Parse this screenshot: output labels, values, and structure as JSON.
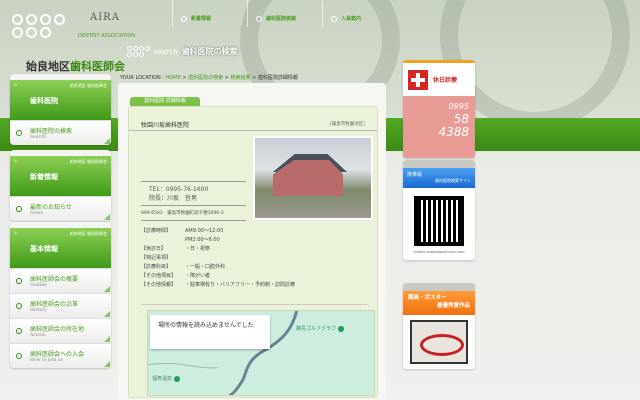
{
  "header": {
    "logo_text": "AIRA",
    "logo_sub": "DENTIST ASSOCIATION",
    "title_plain": "始良地区",
    "title_accent": "歯科医師会"
  },
  "top_nav": [
    {
      "label": "新着情報"
    },
    {
      "label": "歯科医院検索"
    },
    {
      "label": "入会案内"
    }
  ],
  "section_heading": {
    "search_word": "search",
    "title": "歯科医院の検索"
  },
  "breadcrumb": {
    "prefix": "YOUR LOCATION",
    "items": [
      "HOME",
      "歯科医院の検索",
      "検索結果"
    ],
    "current": "歯科医院詳細情報"
  },
  "sidebar": [
    {
      "sub": "姶良地区 歯科医師会",
      "title": "歯科医院",
      "items": [
        {
          "label": "歯科医院の検索",
          "en": "Search"
        }
      ]
    },
    {
      "sub": "姶良地区 歯科医師会",
      "title": "新着情報",
      "items": [
        {
          "label": "最新のお知らせ",
          "en": "News"
        }
      ]
    },
    {
      "sub": "姶良地区 歯科医師会",
      "title": "基本情報",
      "items": [
        {
          "label": "歯科医師会の概要",
          "en": "Outline"
        },
        {
          "label": "歯科医師会の沿革",
          "en": "History"
        },
        {
          "label": "歯科医師会の所在地",
          "en": "Access"
        },
        {
          "label": "歯科医師会への入会",
          "en": "How to join us"
        }
      ]
    }
  ],
  "detail": {
    "tab": "歯科医院 詳細情報",
    "name": "牧園川坂歯科医院",
    "area": "[霧島市牧園地区]",
    "tel": "TEL：0995-76-1600",
    "director": "院長：川坂　哲男",
    "address": "899-6503　霧島市牧園町高千穂3096-3",
    "rows": [
      {
        "k": "【診療時間】",
        "v": "AM9:00～12:00"
      },
      {
        "k": "",
        "v": "PM2:00～6:00"
      },
      {
        "k": "【休診日】",
        "v": "・日・祝祭"
      },
      {
        "k": "【特記事項】",
        "v": ""
      },
      {
        "k": "【診療科目】",
        "v": "・一般・口腔外科"
      },
      {
        "k": "【その他項目】",
        "v": "・障がい者"
      },
      {
        "k": "【その他情報】",
        "v": "・駐車場有り・バリアフリー・予約制・訪問診療"
      }
    ]
  },
  "map": {
    "error": "場所の情報を読み込めませんでした",
    "poi1": "霧島ゴルフクラブ",
    "poi2": "福寿温泉"
  },
  "right": {
    "holiday_label": "休日診療",
    "phone": [
      "0995",
      "58",
      "4388"
    ],
    "mobile_label": "携帯版",
    "mobile_sub": "歯科医院検索サイト",
    "mobile_url": "mobile.aidaikagoshimsu.com",
    "poster_line1": "図画・ポスター",
    "poster_line2": "最優秀賞作品"
  }
}
